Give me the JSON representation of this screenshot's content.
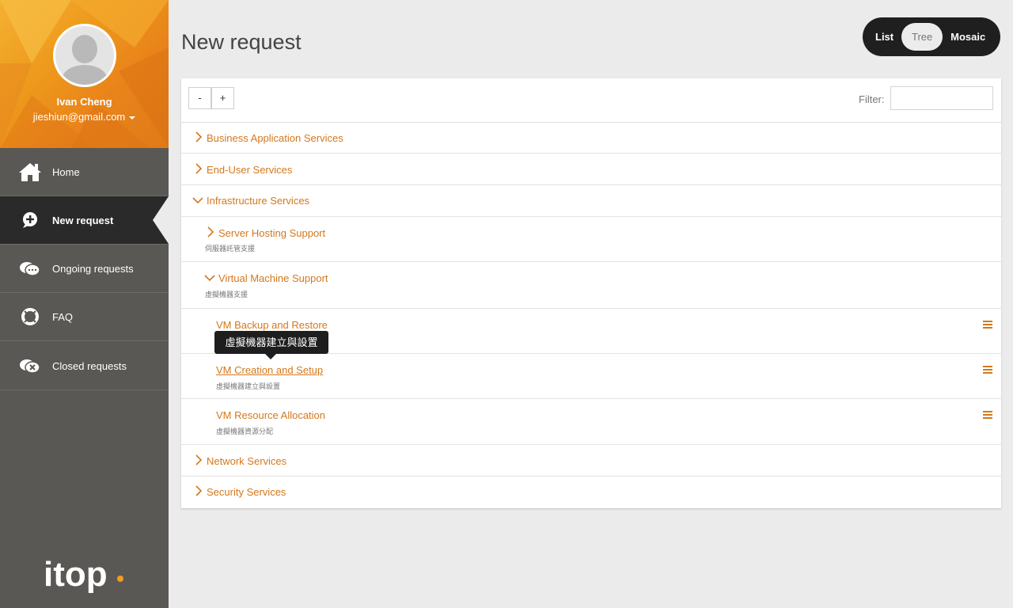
{
  "user": {
    "name": "Ivan Cheng",
    "email": "jieshiun@gmail.com"
  },
  "nav": [
    {
      "label": "Home",
      "icon": "home-icon"
    },
    {
      "label": "New request",
      "icon": "plus-bubble-icon",
      "active": true
    },
    {
      "label": "Ongoing requests",
      "icon": "chat-bubbles-icon"
    },
    {
      "label": "FAQ",
      "icon": "lifebuoy-icon"
    },
    {
      "label": "Closed requests",
      "icon": "closed-bubble-icon"
    }
  ],
  "logo": {
    "text": "itop"
  },
  "page": {
    "title": "New request"
  },
  "view_toggle": {
    "list": "List",
    "tree": "Tree",
    "mosaic": "Mosaic",
    "selected": "Tree"
  },
  "toolbar": {
    "collapse_label": "-",
    "expand_label": "+",
    "filter_label": "Filter:",
    "filter_value": ""
  },
  "tree": {
    "business": {
      "label": "Business Application Services"
    },
    "enduser": {
      "label": "End-User Services"
    },
    "infra": {
      "label": "Infrastructure Services",
      "server_hosting": {
        "label": "Server Hosting Support",
        "sub": "伺服器託管支援"
      },
      "vm_support": {
        "label": "Virtual Machine Support",
        "sub": "虛擬機器支援",
        "items": [
          {
            "label": "VM Backup and Restore",
            "sub": ""
          },
          {
            "label": "VM Creation and Setup",
            "sub": "虛擬機器建立與設置"
          },
          {
            "label": "VM Resource Allocation",
            "sub": "虛擬機器資源分配"
          }
        ]
      }
    },
    "network": {
      "label": "Network Services"
    },
    "security": {
      "label": "Security Services"
    }
  },
  "tooltip": {
    "text": "虛擬機器建立與設置"
  },
  "colors": {
    "accent": "#d4781c",
    "sidebar": "#595855",
    "active_nav": "#2a2a2a",
    "user_panel": "#ee9a1c"
  }
}
